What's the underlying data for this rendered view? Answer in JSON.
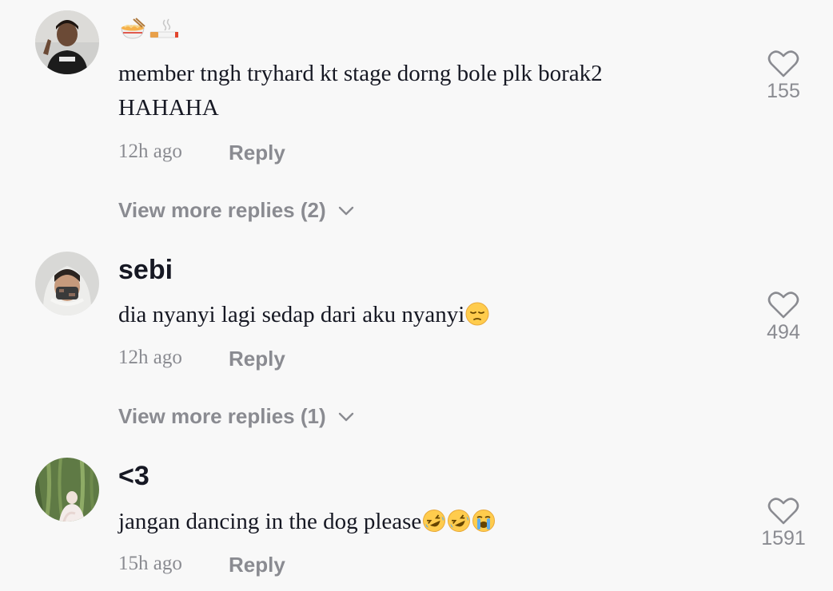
{
  "comments": [
    {
      "username": "",
      "username_icons": [
        "ramen-bowl-emoji",
        "cigarette-emoji"
      ],
      "text": "member tngh tryhard kt stage dorng bole plk borak2\nHAHAHA",
      "text_emojis": [],
      "time": "12h ago",
      "reply_label": "Reply",
      "likes": "155",
      "view_more": "View more replies (2)"
    },
    {
      "username": "sebi",
      "text": "dia nyanyi lagi sedap dari aku nyanyi",
      "text_emojis": [
        "pensive-face-emoji"
      ],
      "time": "12h ago",
      "reply_label": "Reply",
      "likes": "494",
      "view_more": "View more replies (1)"
    },
    {
      "username": "<3",
      "text": "jangan dancing in the dog please",
      "text_emojis": [
        "rofl-emoji",
        "rofl-emoji",
        "crying-face-emoji"
      ],
      "time": "15h ago",
      "reply_label": "Reply",
      "likes": "1591"
    }
  ],
  "colors": {
    "background": "#f8f8f8",
    "primary_text": "#161823",
    "secondary_text": "#8a8b91"
  }
}
